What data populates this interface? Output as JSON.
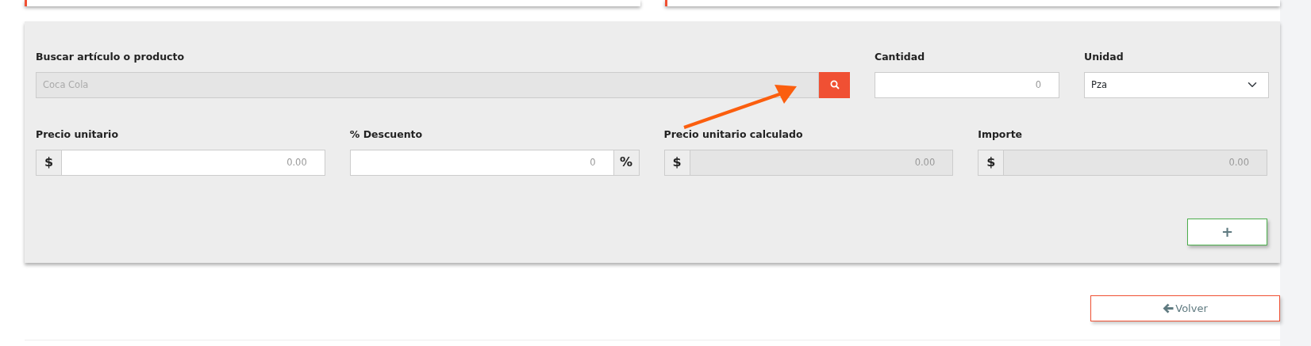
{
  "search": {
    "label": "Buscar artículo o producto",
    "value": "Coca Cola",
    "disabled": true
  },
  "quantity": {
    "label": "Cantidad",
    "placeholder": "0"
  },
  "unit": {
    "label": "Unidad",
    "value": "Pza"
  },
  "price_fields": [
    {
      "label": "Precio unitario",
      "kind": "prefix",
      "addon": "$",
      "placeholder": "0.00",
      "disabled": false
    },
    {
      "label": "% Descuento",
      "kind": "suffix",
      "addon": "%",
      "placeholder": "0",
      "disabled": false
    },
    {
      "label": "Precio unitario calculado",
      "kind": "prefix",
      "addon": "$",
      "placeholder": "0.00",
      "disabled": true
    },
    {
      "label": "Importe",
      "kind": "prefix",
      "addon": "$",
      "placeholder": "0.00",
      "disabled": true
    }
  ],
  "add_button": {
    "label": "+"
  },
  "back_button": {
    "label": "Volver"
  }
}
